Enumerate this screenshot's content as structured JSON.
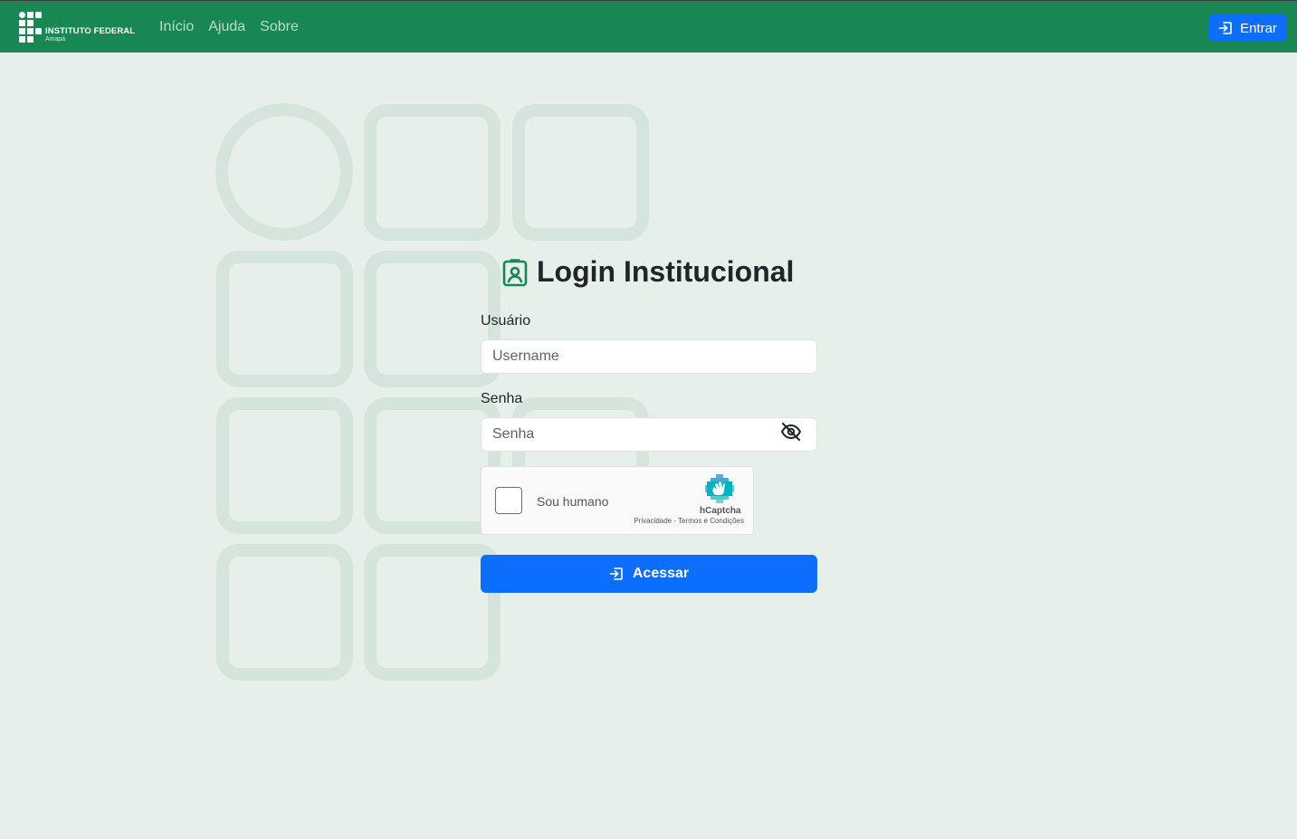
{
  "colors": {
    "navbar": "#198754",
    "primary": "#0d6efd",
    "background": "#e6efea",
    "accent_icon": "#198754"
  },
  "brand": {
    "title": "INSTITUTO FEDERAL",
    "subtitle": "Amapá"
  },
  "nav": {
    "items": [
      {
        "label": "Início"
      },
      {
        "label": "Ajuda"
      },
      {
        "label": "Sobre"
      }
    ],
    "login_button": {
      "label": "Entrar",
      "icon": "login-icon"
    }
  },
  "form": {
    "title": "Login Institucional",
    "title_icon": "badge-icon",
    "username": {
      "label": "Usuário",
      "placeholder": "Username",
      "value": ""
    },
    "password": {
      "label": "Senha",
      "placeholder": "Senha",
      "value": "",
      "toggle_icon": "eye-slash-icon"
    },
    "captcha": {
      "label": "Sou humano",
      "brand": "hCaptcha",
      "links": "Privacidade - Termos e Condições",
      "checked": false
    },
    "submit": {
      "label": "Acessar",
      "icon": "login-icon"
    }
  }
}
